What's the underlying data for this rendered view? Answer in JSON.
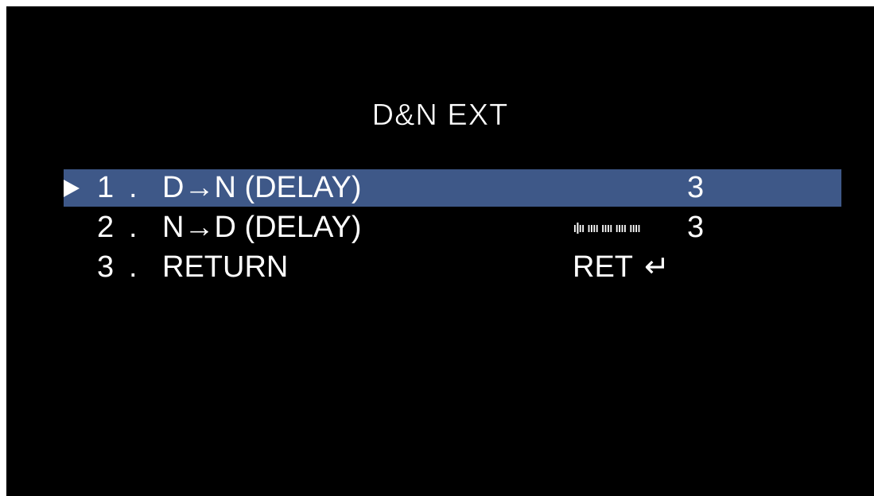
{
  "menu": {
    "title": "D&N EXT",
    "items": [
      {
        "number": "1",
        "separator": ".",
        "label": "D→N  (DELAY)",
        "value": "3",
        "selected": true,
        "level_fraction": 0.05
      },
      {
        "number": "2",
        "separator": ".",
        "label": "N→D  (DELAY)",
        "value": "3",
        "selected": false,
        "level_fraction": 0.05
      },
      {
        "number": "3",
        "separator": ".",
        "label": "RETURN",
        "value": "RET",
        "return_icon": "↵",
        "selected": false
      }
    ]
  },
  "colors": {
    "background": "#000000",
    "selection": "#3e5888",
    "text": "#ffffff"
  },
  "icons": {
    "cursor": "triangle-right-icon",
    "return": "return-arrow-icon"
  }
}
